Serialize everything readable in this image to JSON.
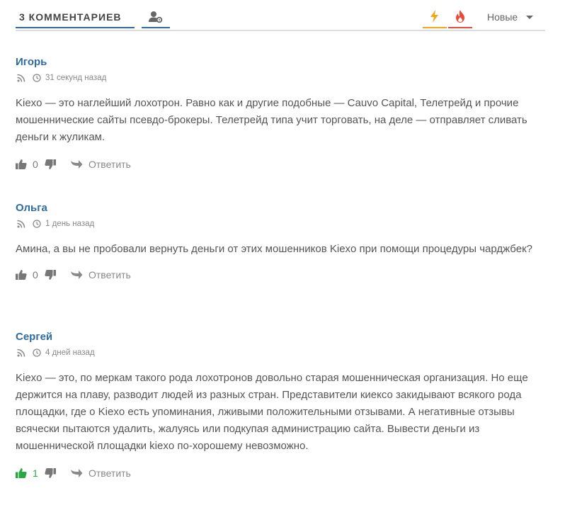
{
  "header": {
    "count_label": "3 КОММЕНТАРИЕВ",
    "sort_label": "Новые",
    "icons": {
      "settings": "user-settings-icon",
      "hot": "lightning-icon",
      "popular": "fire-icon",
      "caret": "caret-down-icon"
    },
    "colors": {
      "accent": "#2e6b9e",
      "hot": "#f2a61c",
      "fire": "#e74c3c",
      "positive": "#28a745"
    }
  },
  "comments": [
    {
      "author": "Игорь",
      "time": "31 секунд назад",
      "text": "Kiexo — это наглейший лохотрон. Равно как и другие подобные — Cauvo Capital, Телетрейд и прочие мошеннические сайты псевдо-брокеры. Телетрейд типа учит торговать, на деле — отправляет сливать деньги к жуликам.",
      "votes": "0",
      "reply_label": "Ответить"
    },
    {
      "author": "Ольга",
      "time": "1 день назад",
      "text": "Амина, а вы не пробовали вернуть деньги от этих мошенников Kiexo при помощи процедуры чарджбек?",
      "votes": "0",
      "reply_label": "Ответить"
    },
    {
      "author": "Сергей",
      "time": "4 дней назад",
      "text": "Kiexo — это, по меркам такого рода лохотронов довольно старая мошенническая организация. Но еще держится на плаву, разводит людей из разных стран. Представители киексо закидывают всякого рода площадки, где о Kiexo есть упоминания, лживыми положительными отзывами. А негативные отзывы всячески пытаются удалить, жалуясь или подкупая администрацию сайта. Вывести деньги из мошеннической площадки kiexo по-хорошему невозможно.",
      "votes": "1",
      "reply_label": "Ответить"
    }
  ]
}
